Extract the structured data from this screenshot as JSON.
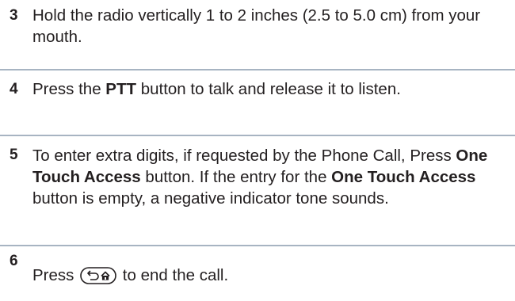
{
  "steps": [
    {
      "number": "3",
      "parts": [
        "Hold the radio vertically 1 to 2 inches (2.5 to 5.0 cm) from your mouth."
      ]
    },
    {
      "number": "4",
      "parts": [
        "Press the ",
        "PTT",
        " button to talk and release it to listen."
      ]
    },
    {
      "number": "5",
      "parts": [
        "To enter extra digits, if requested by the Phone Call, Press ",
        "One Touch Access",
        " button. If the entry for the ",
        "One Touch Access",
        " button is empty, a negative indicator tone sounds."
      ]
    },
    {
      "number": "6",
      "parts": [
        "Press ",
        " to end the call."
      ],
      "key_icon": "back-home-key-icon"
    }
  ],
  "colors": {
    "text": "#231f20",
    "rule": "#a7b4c2"
  }
}
